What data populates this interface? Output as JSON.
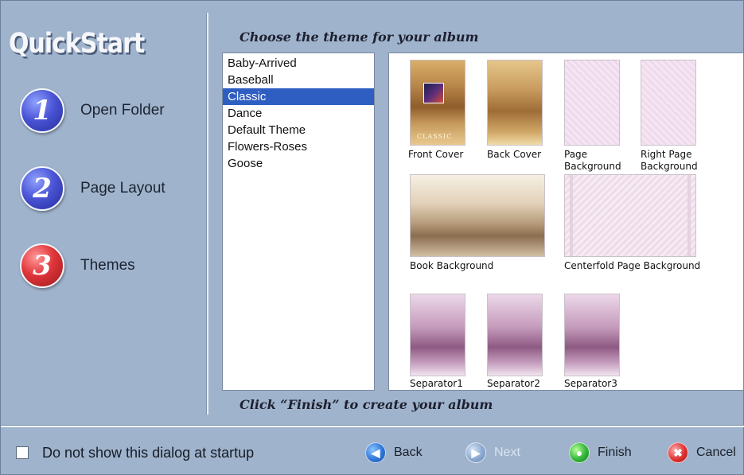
{
  "logo": "QuickStart",
  "steps": [
    {
      "number": "1",
      "label": "Open Folder"
    },
    {
      "number": "2",
      "label": "Page Layout"
    },
    {
      "number": "3",
      "label": "Themes"
    }
  ],
  "header_text": "Choose the theme for your album",
  "footer_hint": "Click “Finish” to create your album",
  "themes": [
    "Baby-Arrived",
    "Baseball",
    "Classic",
    "Dance",
    "Default Theme",
    "Flowers-Roses",
    "Goose"
  ],
  "selected_theme": "Classic",
  "assets": [
    {
      "label": "Front Cover",
      "cover_text": "CLASSIC"
    },
    {
      "label": "Back Cover"
    },
    {
      "label": "Page\nBackground"
    },
    {
      "label": "Right Page\nBackground"
    },
    {
      "label": "Book Background"
    },
    {
      "label": "Centerfold Page Background"
    },
    {
      "label": "Separator1"
    },
    {
      "label": "Separator2"
    },
    {
      "label": "Separator3"
    }
  ],
  "footer": {
    "checkbox_label": "Do not show this dialog at startup",
    "checkbox_checked": false,
    "buttons": {
      "back": "Back",
      "next": "Next",
      "finish": "Finish",
      "cancel": "Cancel"
    }
  },
  "colors": {
    "background": "#9fb3cc",
    "selection": "#2f5ec2"
  }
}
